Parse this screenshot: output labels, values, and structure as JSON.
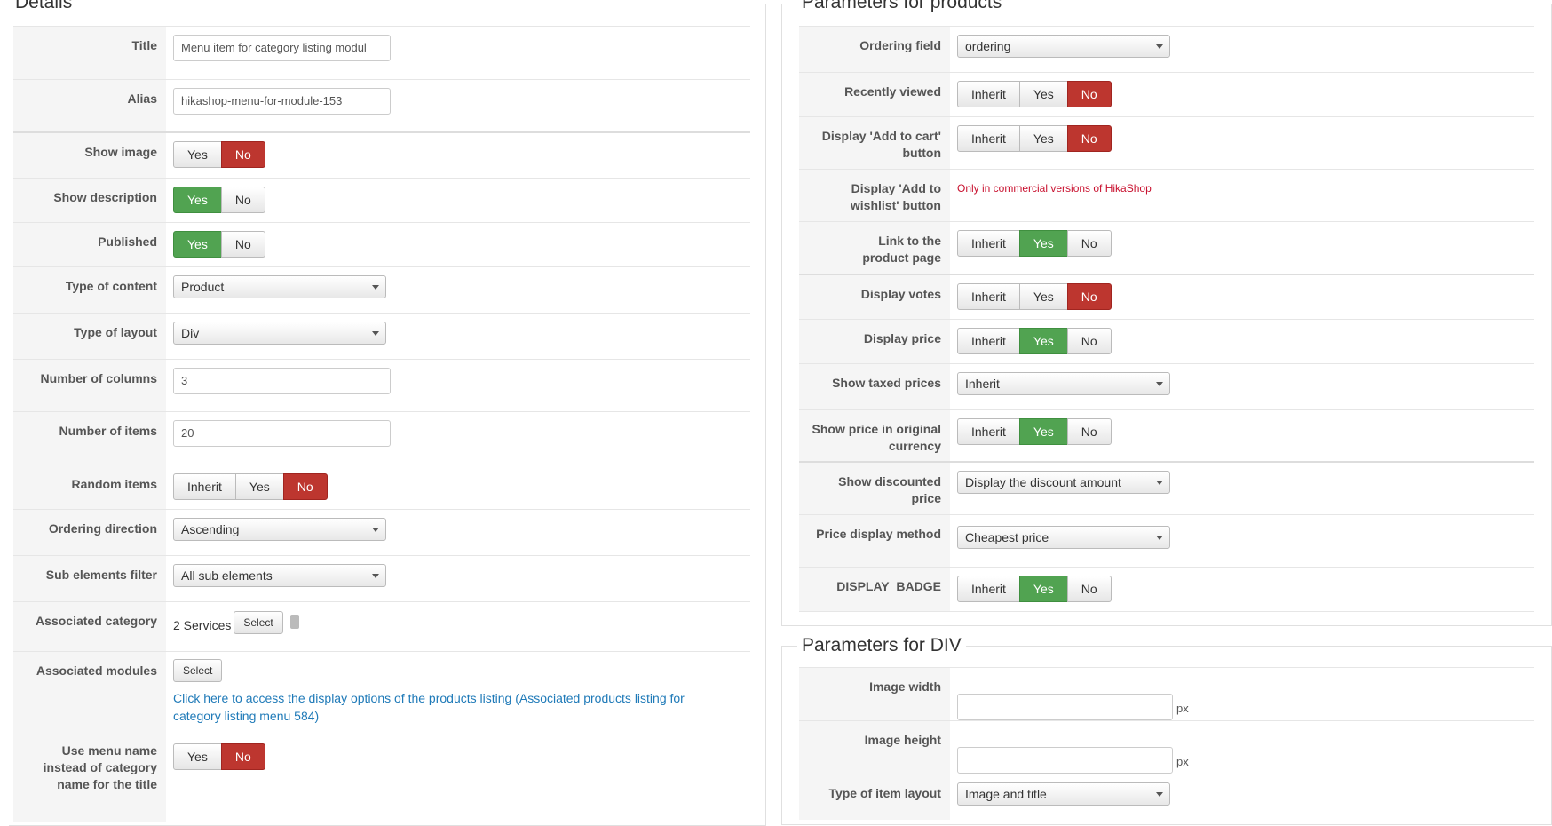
{
  "details": {
    "legend": "Details",
    "title_label": "Title",
    "title_value": "Menu item for category listing modul",
    "alias_label": "Alias",
    "alias_value": "hikashop-menu-for-module-153",
    "show_image_label": "Show image",
    "show_description_label": "Show description",
    "published_label": "Published",
    "type_content_label": "Type of content",
    "type_content_value": "Product",
    "type_layout_label": "Type of layout",
    "type_layout_value": "Div",
    "num_columns_label": "Number of columns",
    "num_columns_value": "3",
    "num_items_label": "Number of items",
    "num_items_value": "20",
    "random_items_label": "Random items",
    "ordering_direction_label": "Ordering direction",
    "ordering_direction_value": "Ascending",
    "sub_elements_label": "Sub elements filter",
    "sub_elements_value": "All sub elements",
    "assoc_category_label": "Associated category",
    "assoc_category_value": "2 Services",
    "select_label": "Select",
    "assoc_modules_label": "Associated modules",
    "assoc_modules_link": "Click here to access the display options of the products listing (Associated products listing for category listing menu 584)",
    "use_menu_name_label": "Use menu name instead of category name for the title"
  },
  "params_products": {
    "legend": "Parameters for products",
    "ordering_field_label": "Ordering field",
    "ordering_field_value": "ordering",
    "recently_viewed_label": "Recently viewed",
    "add_to_cart_label": "Display 'Add to cart' button",
    "add_to_wishlist_label": "Display 'Add to wishlist' button",
    "wishlist_note": "Only in commercial versions of HikaShop",
    "link_product_label": "Link to the product page",
    "display_votes_label": "Display votes",
    "display_price_label": "Display price",
    "show_taxed_label": "Show taxed prices",
    "show_taxed_value": "Inherit",
    "original_currency_label": "Show price in original currency",
    "discounted_label": "Show discounted price",
    "discounted_value": "Display the discount amount",
    "price_method_label": "Price display method",
    "price_method_value": "Cheapest price",
    "badge_label": "DISPLAY_BADGE"
  },
  "params_div": {
    "legend": "Parameters for DIV",
    "image_width_label": "Image width",
    "image_height_label": "Image height",
    "px": "px",
    "item_layout_label": "Type of item layout",
    "item_layout_value": "Image and title"
  },
  "buttons": {
    "inherit": "Inherit",
    "yes": "Yes",
    "no": "No"
  },
  "colors": {
    "no_active": "#bd362f",
    "yes_active": "#51a351",
    "link": "#1f7ab8",
    "note": "#c8102e"
  }
}
